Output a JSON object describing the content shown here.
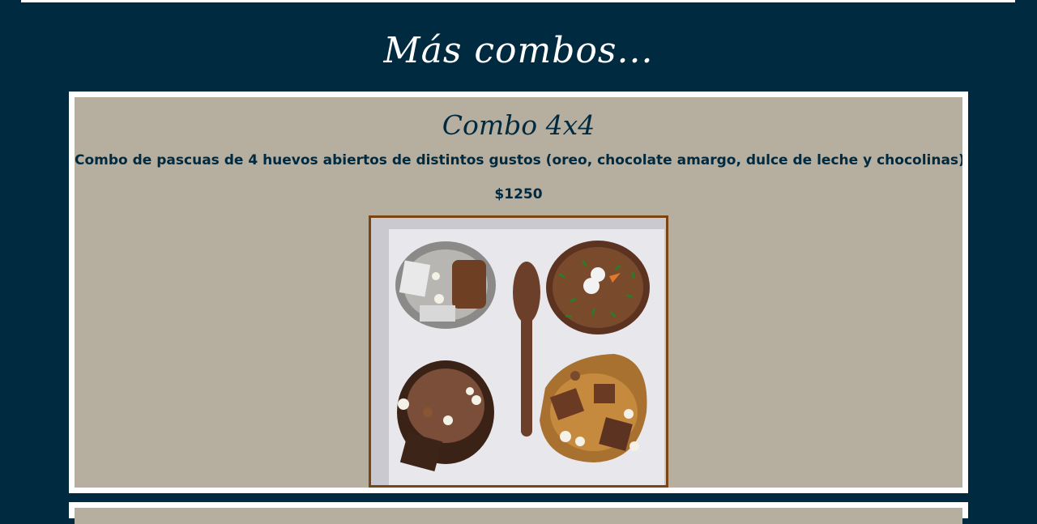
{
  "section": {
    "title": "Más combos..."
  },
  "product": {
    "title": "Combo 4x4",
    "description": "Combo de pascuas de 4 huevos abiertos de distintos gustos (oreo, chocolate amargo, dulce de leche y chocolinas)",
    "price": "$1250",
    "image_alt": "Combo 4x4"
  },
  "colors": {
    "page_background": "#002a40",
    "card_background": "#b6ae9e",
    "card_border": "#ffffff",
    "text": "#002a40",
    "photo_border": "#7a4513"
  }
}
